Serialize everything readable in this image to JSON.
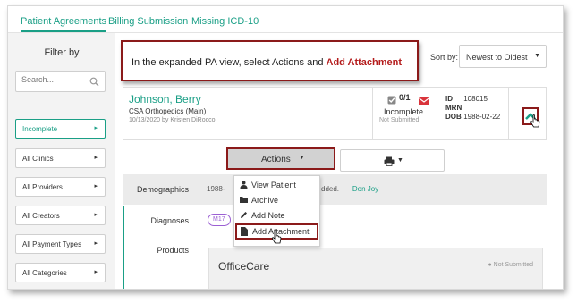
{
  "tabs": [
    {
      "label": "Patient Agreements",
      "active": true
    },
    {
      "label": "Billing Submission",
      "active": false
    },
    {
      "label": "Missing ICD-10",
      "active": false
    }
  ],
  "sidebar": {
    "filter_title": "Filter by",
    "search_placeholder": "Search...",
    "filters": [
      {
        "label": "Incomplete",
        "selected": true
      },
      {
        "label": "All Clinics"
      },
      {
        "label": "All Providers"
      },
      {
        "label": "All Creators"
      },
      {
        "label": "All Payment Types"
      },
      {
        "label": "All Categories"
      }
    ]
  },
  "callout": {
    "text": "In the expanded PA view, select Actions and ",
    "highlight": "Add Attachment"
  },
  "sort": {
    "label": "Sort by:",
    "value": "Newest to Oldest"
  },
  "patient": {
    "name": "Johnson, Berry",
    "clinic": "CSA Orthopedics (Main)",
    "created": "10/13/2020 by Kristen DiRocco",
    "status_count": "0/1",
    "status": "Incomplete",
    "status_sub": "Not Submitted",
    "id_label": "ID",
    "id_value": "108015",
    "mrn_label": "MRN",
    "mrn_value": "",
    "dob_label": "DOB",
    "dob_value": "1988-02-22"
  },
  "actions": {
    "button_label": "Actions",
    "menu": [
      {
        "label": "View Patient",
        "icon": "user-icon"
      },
      {
        "label": "Archive",
        "icon": "folder-icon"
      },
      {
        "label": "Add Note",
        "icon": "pencil-icon"
      },
      {
        "label": "Add Attachment",
        "icon": "file-icon"
      }
    ]
  },
  "details": {
    "demographics_label": "Demographics",
    "demographics_value": "1988-",
    "demographics_tail": "dded.",
    "demographics_link": "Don Joy",
    "diagnoses_label": "Diagnoses",
    "diagnosis_tag": "M17",
    "products_label": "Products",
    "product_name": "OfficeCare",
    "product_status": "Not Submitted"
  },
  "colors": {
    "accent": "#1a9f86",
    "highlight_border": "#8b1a1a",
    "highlight_text": "#b41c1c"
  }
}
